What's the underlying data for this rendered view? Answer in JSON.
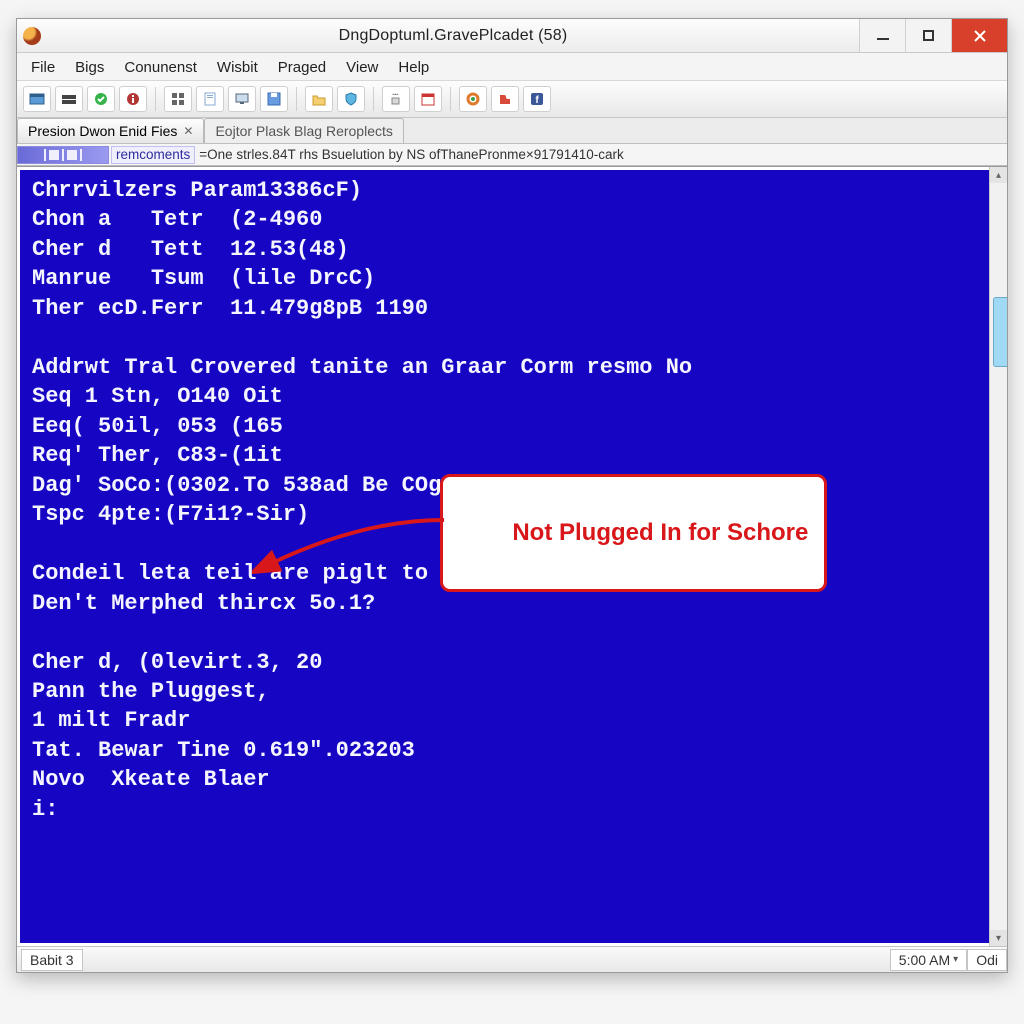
{
  "window": {
    "title": "DngDoptuml.GravePlcadet (58)"
  },
  "menu": {
    "items": [
      "File",
      "Bigs",
      "Conunenst",
      "Wisbit",
      "Praged",
      "View",
      "Help"
    ]
  },
  "tabs": [
    {
      "label": "Presion Dwon Enid Fies",
      "active": true,
      "closable": true
    },
    {
      "label": "Eojtor Plask Blag Reroplects",
      "active": false,
      "closable": false
    }
  ],
  "headerRow": {
    "label": "remcoments",
    "path": "=One strles.84T rhs Bsuelution by NS ofThanePronme×91791410-cark"
  },
  "console": {
    "lines": [
      "Chrrvilzers Param13386cF)",
      "Chon a   Tetr  (2-4960",
      "Cher d   Tett  12.53(48)",
      "Manrue   Tsum  (lile DrcC)",
      "Ther ecD.Ferr  11.479g8pB 1190",
      "",
      "Addrwt Tral Crovered tanite an Graar Corm resmo No",
      "Seq 1 Stn, O140 Oit",
      "Eeq( 50il, 053 (165",
      "Req' Ther, C83-(1it",
      "Dag' SoCo:(0302.To 538ad Be COgA 11 725)",
      "Tspc 4pte:(F7i1?-Sir)",
      "",
      "Condeil leta teil are piglt to as:de.io thH),",
      "Den't Merphed thircx 5o.1?",
      "",
      "Cher d, (0levirt.3, 20",
      "Pann the Pluggest,",
      "1 milt Fradr",
      "Tat. Bewar Tine 0.619\".023203",
      "Novo  Xkeate Blaer",
      "i:"
    ]
  },
  "callout": {
    "text": "Not Plugged In for Schore"
  },
  "status": {
    "left": "Babit 3",
    "time": "5:00 AM",
    "right": "Odi"
  },
  "colors": {
    "consoleBg": "#1606c3",
    "closeBtn": "#d9402b",
    "calloutRed": "#d8171a"
  }
}
